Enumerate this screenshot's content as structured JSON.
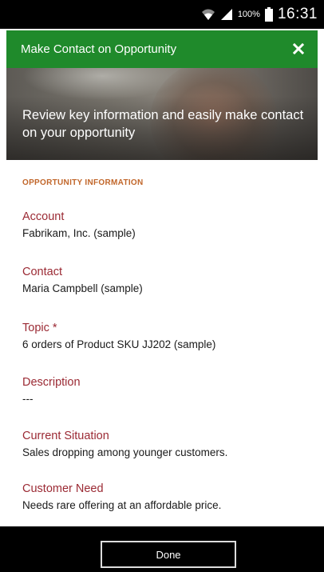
{
  "status_bar": {
    "battery_percent": "100%",
    "time": "16:31",
    "icons": [
      "wifi-icon",
      "signal-icon",
      "battery-icon"
    ]
  },
  "header": {
    "title": "Make Contact on Opportunity",
    "close_icon": "close-icon",
    "color": "#1f8a2b"
  },
  "hero": {
    "text": "Review key information and easily make contact on your opportunity"
  },
  "section": {
    "title": "OPPORTUNITY INFORMATION",
    "title_color": "#c1662a",
    "label_color": "#9b2a34"
  },
  "fields": [
    {
      "label": "Account",
      "value": "Fabrikam, Inc. (sample)"
    },
    {
      "label": "Contact",
      "value": "Maria Campbell (sample)"
    },
    {
      "label": "Topic",
      "required_mark": "*",
      "value": "6 orders of Product SKU JJ202 (sample)"
    },
    {
      "label": "Description",
      "value": "---"
    },
    {
      "label": "Current Situation",
      "value": "Sales dropping among younger customers."
    },
    {
      "label": "Customer Need",
      "value": "Needs rare offering at an affordable price."
    }
  ],
  "footer": {
    "done_label": "Done"
  }
}
